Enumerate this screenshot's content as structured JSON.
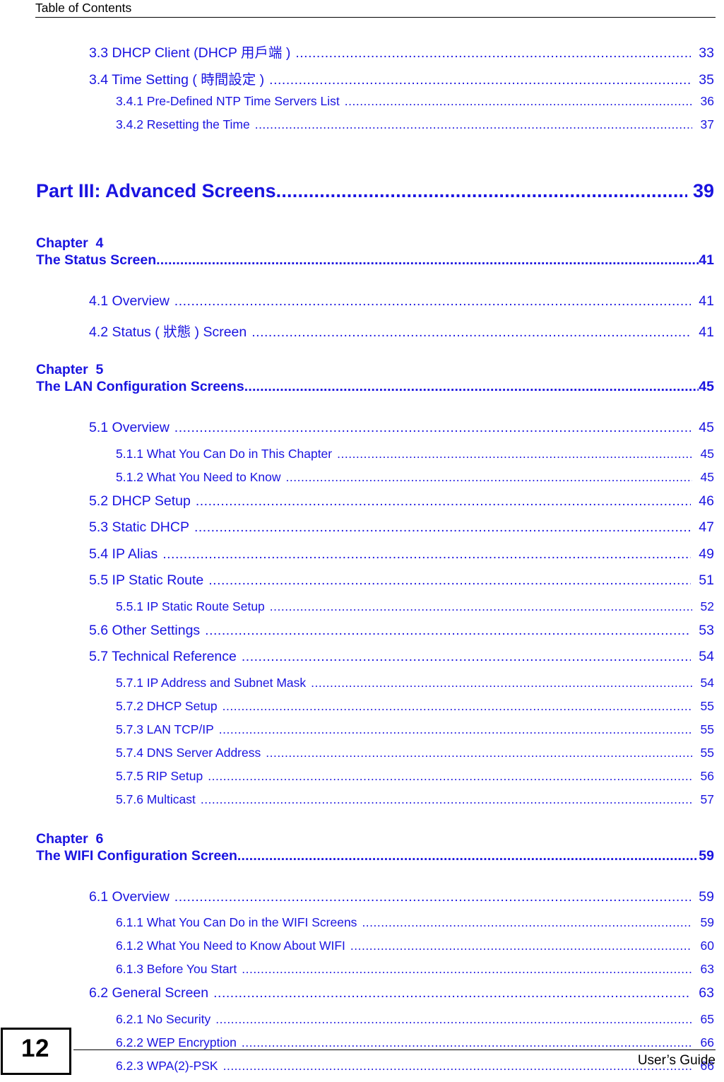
{
  "header": {
    "title": "Table of Contents"
  },
  "toc": {
    "group_a": [
      {
        "label": "3.3 DHCP Client (DHCP 用戶端 )",
        "page": "33",
        "level": 2
      },
      {
        "label": "3.4 Time Setting ( 時間設定 )",
        "page": "35",
        "level": 2
      },
      {
        "label": "3.4.1 Pre-Defined NTP Time Servers List",
        "page": "36",
        "level": 3
      },
      {
        "label": "3.4.2 Resetting the Time",
        "page": "37",
        "level": 3
      }
    ],
    "part": {
      "label": "Part III: Advanced Screens",
      "page": "39"
    },
    "chapter4": {
      "chapter_label": "Chapter  4",
      "title": "The Status Screen",
      "page": "41",
      "entries": [
        {
          "label": "4.1 Overview",
          "page": "41",
          "level": 2
        },
        {
          "label": "4.2 Status ( 狀態 ) Screen",
          "page": "41",
          "level": 2
        }
      ]
    },
    "chapter5": {
      "chapter_label": "Chapter  5",
      "title": "The LAN Configuration Screens",
      "page": "45",
      "entries": [
        {
          "label": "5.1 Overview",
          "page": "45",
          "level": 2
        },
        {
          "label": "5.1.1 What You Can Do in This Chapter",
          "page": "45",
          "level": 3
        },
        {
          "label": "5.1.2 What You Need to Know",
          "page": "45",
          "level": 3
        },
        {
          "label": "5.2 DHCP Setup",
          "page": "46",
          "level": 2
        },
        {
          "label": "5.3 Static DHCP",
          "page": "47",
          "level": 2
        },
        {
          "label": "5.4 IP Alias",
          "page": "49",
          "level": 2
        },
        {
          "label": "5.5 IP Static Route",
          "page": "51",
          "level": 2
        },
        {
          "label": "5.5.1 IP Static Route Setup",
          "page": "52",
          "level": 3
        },
        {
          "label": "5.6 Other Settings",
          "page": "53",
          "level": 2
        },
        {
          "label": "5.7 Technical Reference",
          "page": "54",
          "level": 2
        },
        {
          "label": "5.7.1 IP Address and Subnet Mask",
          "page": "54",
          "level": 3
        },
        {
          "label": "5.7.2 DHCP Setup",
          "page": "55",
          "level": 3
        },
        {
          "label": "5.7.3 LAN TCP/IP",
          "page": "55",
          "level": 3
        },
        {
          "label": "5.7.4 DNS Server Address",
          "page": "55",
          "level": 3
        },
        {
          "label": "5.7.5 RIP Setup",
          "page": "56",
          "level": 3
        },
        {
          "label": "5.7.6 Multicast",
          "page": "57",
          "level": 3
        }
      ]
    },
    "chapter6": {
      "chapter_label": "Chapter  6",
      "title": "The WIFI Configuration Screen ",
      "page": "59",
      "entries": [
        {
          "label": "6.1 Overview",
          "page": "59",
          "level": 2
        },
        {
          "label": "6.1.1 What You Can Do in the WIFI Screens",
          "page": "59",
          "level": 3
        },
        {
          "label": "6.1.2 What You Need to Know About WIFI",
          "page": "60",
          "level": 3
        },
        {
          "label": "6.1.3 Before You Start",
          "page": "63",
          "level": 3
        },
        {
          "label": "6.2 General Screen  ",
          "page": "63",
          "level": 2
        },
        {
          "label": "6.2.1 No Security",
          "page": "65",
          "level": 3
        },
        {
          "label": "6.2.2 WEP Encryption",
          "page": "66",
          "level": 3
        },
        {
          "label": "6.2.3 WPA(2)-PSK",
          "page": "66",
          "level": 3
        }
      ]
    }
  },
  "footer": {
    "page_number": "12",
    "guide_label": "User’s Guide"
  },
  "colors": {
    "link_blue": "#1A14E0",
    "text_black": "#000000",
    "background": "#FFFFFF"
  }
}
